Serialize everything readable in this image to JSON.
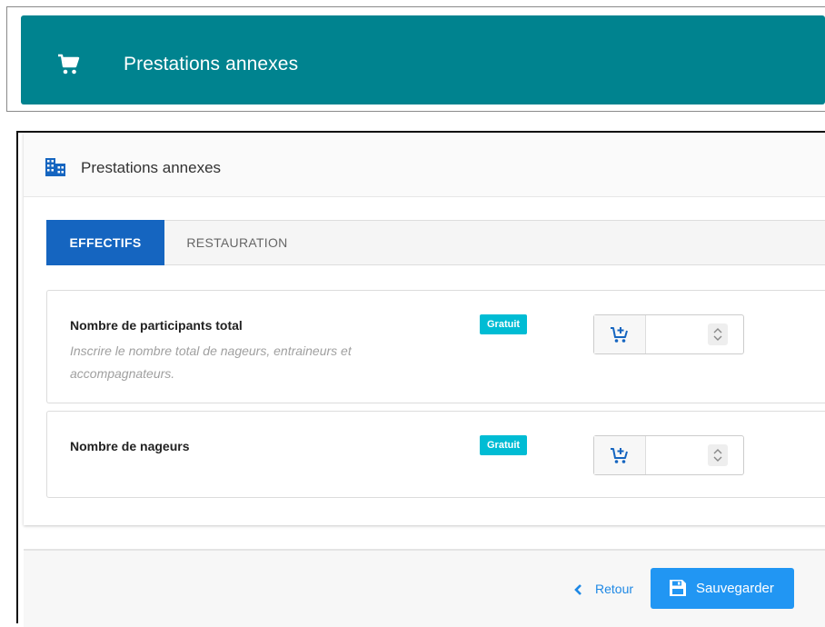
{
  "banner": {
    "title": "Prestations annexes",
    "icon": "cart-icon"
  },
  "panel": {
    "title": "Prestations annexes",
    "icon": "building-icon",
    "tabs": [
      {
        "label": "EFFECTIFS",
        "active": true
      },
      {
        "label": "RESTAURATION",
        "active": false
      }
    ],
    "services": [
      {
        "title": "Nombre de participants total",
        "description": "Inscrire le nombre total de nageurs, entraineurs et accompagnateurs.",
        "badge": "Gratuit",
        "value": "",
        "addon_icon": "cart-plus-icon"
      },
      {
        "title": "Nombre de nageurs",
        "description": "",
        "badge": "Gratuit",
        "value": "",
        "addon_icon": "cart-plus-icon"
      }
    ]
  },
  "footer": {
    "back_label": "Retour",
    "save_label": "Sauvegarder"
  },
  "colors": {
    "banner": "#00838f",
    "tab_active": "#1565c0",
    "badge": "#00bcd4",
    "save_button": "#2196f3",
    "link": "#1e88e5"
  }
}
